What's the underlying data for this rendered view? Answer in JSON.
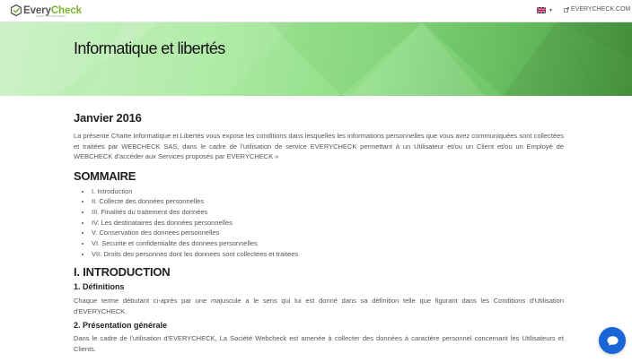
{
  "header": {
    "logo_every": "Every",
    "logo_check": "Check",
    "logo_tagline": "SAFETY WITH EFFICIENCY",
    "language_flag": "uk-flag-icon",
    "external_link_label": "EVERYCHECK.COM"
  },
  "hero": {
    "title": "Informatique et libertés"
  },
  "content": {
    "date_heading": "Janvier 2016",
    "intro": "La présente Charte Informatique et Libertés vous expose les conditions dans lesquelles les informations personnelles que vous avez communiquées sont collectées et traitées par WEBCHECK SAS, dans le cadre de l'utilisation de service EVERYCHECK permettant à un Utilisateur et/ou un Client et/ou un Employé de WEBCHECK d'accéder aux Services proposés par EVERYCHECK »",
    "summary_heading": "SOMMAIRE",
    "summary_items": [
      "I. Introduction",
      "II. Collecte des données personnelles",
      "III. Finalités du traitement des données",
      "IV. Les destinataires des données personnelles",
      "V. Conservation des donnees personnelles",
      "VI. Securite et confidentialite des donnees personnelles",
      "VII. Droits des personnes dont les donnees sont collectees et traitees"
    ],
    "section1_heading": "I. INTRODUCTION",
    "definitions_heading": "1. Définitions",
    "definitions_text": "Chaque terme débutant ci-après par une majuscule a le sens qui lui est donné dans sa définition telle que figurant dans les Conditions d'Utilisation d'EVERYCHECK.",
    "presentation_heading": "2. Présentation générale",
    "presentation_text": "Dans le cadre de l'utilisation d'EVERYCHECK, La Société Webcheck est amenée à collecter des données à caractère personnel concernant les Utilisateurs et Clients."
  },
  "chat": {
    "icon": "chat-bubble-icon"
  },
  "colors": {
    "brand_green": "#7ab32e",
    "chat_blue": "#1a66d6"
  }
}
